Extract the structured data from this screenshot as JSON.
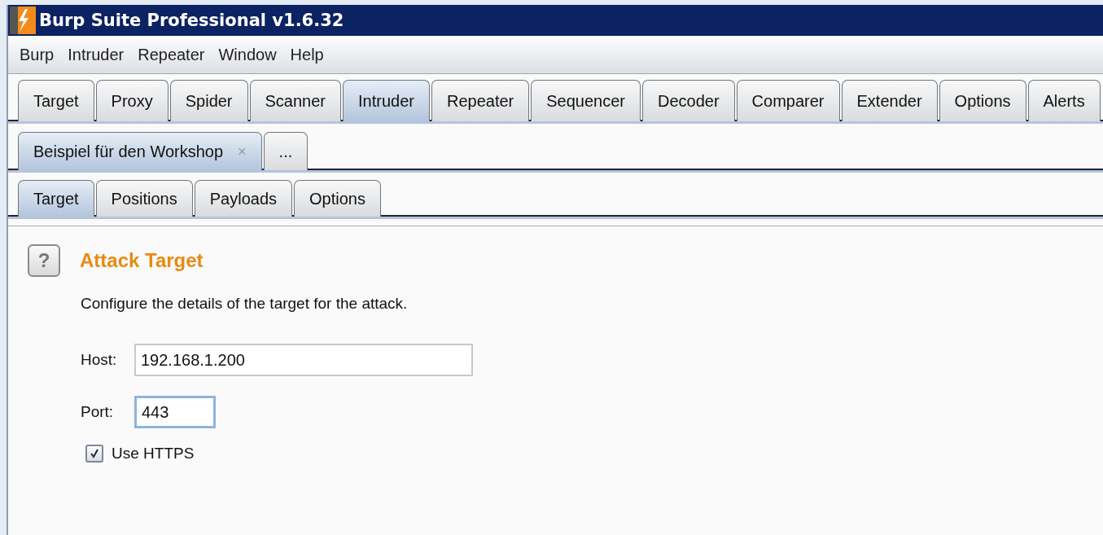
{
  "window": {
    "title": "Burp Suite Professional v1.6.32"
  },
  "menu": [
    "Burp",
    "Intruder",
    "Repeater",
    "Window",
    "Help"
  ],
  "tabs": [
    {
      "label": "Target",
      "selected": false
    },
    {
      "label": "Proxy",
      "selected": false
    },
    {
      "label": "Spider",
      "selected": false
    },
    {
      "label": "Scanner",
      "selected": false
    },
    {
      "label": "Intruder",
      "selected": true
    },
    {
      "label": "Repeater",
      "selected": false
    },
    {
      "label": "Sequencer",
      "selected": false
    },
    {
      "label": "Decoder",
      "selected": false
    },
    {
      "label": "Comparer",
      "selected": false
    },
    {
      "label": "Extender",
      "selected": false
    },
    {
      "label": "Options",
      "selected": false
    },
    {
      "label": "Alerts",
      "selected": false
    }
  ],
  "attack_tabs": [
    {
      "label": "Beispiel für den Workshop",
      "close": "×",
      "selected": true
    },
    {
      "label": "...",
      "selected": false
    }
  ],
  "sub_tabs": [
    {
      "label": "Target",
      "selected": true
    },
    {
      "label": "Positions",
      "selected": false
    },
    {
      "label": "Payloads",
      "selected": false
    },
    {
      "label": "Options",
      "selected": false
    }
  ],
  "panel": {
    "help": "?",
    "heading": "Attack Target",
    "description": "Configure the details of the target for the attack.",
    "host": {
      "label": "Host:",
      "value": "192.168.1.200"
    },
    "port": {
      "label": "Port:",
      "value": "443",
      "focused": true
    },
    "use_https": {
      "label": "Use HTTPS",
      "checked": true
    }
  }
}
